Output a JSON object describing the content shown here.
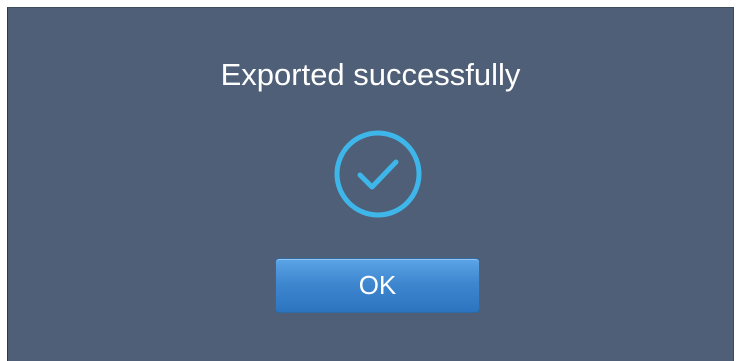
{
  "dialog": {
    "message": "Exported successfully",
    "icon": "check-circle-icon",
    "ok_label": "OK"
  },
  "colors": {
    "background": "#4e5f77",
    "icon": "#3fb6ea",
    "button": "#3f88d0",
    "text": "#ffffff"
  }
}
